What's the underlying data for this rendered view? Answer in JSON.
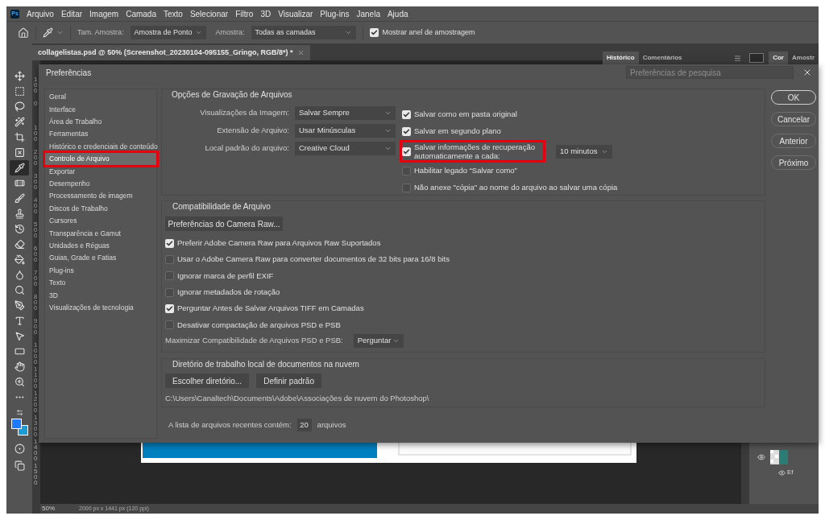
{
  "app": {
    "logo": "Ps",
    "menus": [
      "Arquivo",
      "Editar",
      "Imagem",
      "Camada",
      "Texto",
      "Selecionar",
      "Filtro",
      "3D",
      "Visualizar",
      "Plug-ins",
      "Janela",
      "Ajuda"
    ]
  },
  "options_bar": {
    "sample_size_label": "Tam. Amostra:",
    "sample_size": "Amostra de Ponto",
    "sample_label": "Amostra:",
    "sample": "Todas as camadas",
    "show_ring": {
      "label": "Mostrar anel de amostragem",
      "checked": true
    }
  },
  "tools": [
    {
      "kind": "move",
      "selected": false
    },
    {
      "kind": "marquee",
      "selected": false
    },
    {
      "kind": "lasso",
      "selected": false
    },
    {
      "kind": "wand",
      "selected": false
    },
    {
      "kind": "crop",
      "selected": false
    },
    {
      "kind": "frame",
      "selected": false
    },
    {
      "kind": "eyedropper",
      "selected": true
    },
    {
      "kind": "healing",
      "selected": false
    },
    {
      "kind": "brush",
      "selected": false
    },
    {
      "kind": "stamp",
      "selected": false
    },
    {
      "kind": "history",
      "selected": false
    },
    {
      "kind": "eraser",
      "selected": false
    },
    {
      "kind": "bucket",
      "selected": false
    },
    {
      "kind": "blur",
      "selected": false
    },
    {
      "kind": "dodge",
      "selected": false
    },
    {
      "kind": "pen",
      "selected": false
    },
    {
      "kind": "type",
      "selected": false
    },
    {
      "kind": "path",
      "selected": false
    },
    {
      "kind": "rectangle",
      "selected": false
    },
    {
      "kind": "hand",
      "selected": false
    },
    {
      "kind": "zoom",
      "selected": false
    },
    {
      "kind": "more",
      "selected": false
    }
  ],
  "document_tab": {
    "title": "collagelistas.psd @ 50% (Screenshot_20230104-095155_Gringo, RGB/8*) *"
  },
  "panel_tabs": [
    {
      "label": "Histórico",
      "selected": true
    },
    {
      "label": "Comentários",
      "selected": false
    }
  ],
  "panel_tabs_2": [
    {
      "label": "Cor",
      "selected": true
    },
    {
      "label": "Amostr",
      "selected": false
    }
  ],
  "ruler": [
    "100",
    "0",
    "100",
    "200",
    "300",
    "400",
    "500",
    "600",
    "700",
    "800",
    "900",
    "1000",
    "1100",
    "1200",
    "1300",
    "1400",
    "1500"
  ],
  "dialog": {
    "title": "Preferências",
    "search": {
      "placeholder": "Preferências de pesquisa"
    },
    "categories": [
      {
        "label": "Geral",
        "selected": false,
        "highlighted": false
      },
      {
        "label": "Interface",
        "selected": false,
        "highlighted": false
      },
      {
        "label": "Área de Trabalho",
        "selected": false,
        "highlighted": false
      },
      {
        "label": "Ferramentas",
        "selected": false,
        "highlighted": false
      },
      {
        "label": "Histórico e credenciais de conteúdo",
        "selected": false,
        "highlighted": false
      },
      {
        "label": "Controle de Arquivo",
        "selected": true,
        "highlighted": true
      },
      {
        "label": "Exportar",
        "selected": false,
        "highlighted": false
      },
      {
        "label": "Desempenho",
        "selected": false,
        "highlighted": false
      },
      {
        "label": "Processamento de imagem",
        "selected": false,
        "highlighted": false
      },
      {
        "label": "Discos de Trabalho",
        "selected": false,
        "highlighted": false
      },
      {
        "label": "Cursores",
        "selected": false,
        "highlighted": false
      },
      {
        "label": "Transparência e Gamut",
        "selected": false,
        "highlighted": false
      },
      {
        "label": "Unidades e Réguas",
        "selected": false,
        "highlighted": false
      },
      {
        "label": "Guias, Grade e Fatias",
        "selected": false,
        "highlighted": false
      },
      {
        "label": "Plug-ins",
        "selected": false,
        "highlighted": false
      },
      {
        "label": "Texto",
        "selected": false,
        "highlighted": false
      },
      {
        "label": "3D",
        "selected": false,
        "highlighted": false
      },
      {
        "label": "Visualizações de tecnologia",
        "selected": false,
        "highlighted": false
      }
    ],
    "save_options": {
      "title": "Opções de Gravação de Arquivos",
      "fields": [
        {
          "label": "Visualizações da Imagem:",
          "value": "Salvar Sempre"
        },
        {
          "label": "Extensão de Arquivo:",
          "value": "Usar Minúsculas"
        },
        {
          "label": "Local padrão do arquivo:",
          "value": "Creative Cloud"
        }
      ],
      "checkboxes": [
        {
          "label": "Salvar como em pasta original",
          "checked": true,
          "highlighted": false
        },
        {
          "label": "Salvar em segundo plano",
          "checked": true,
          "highlighted": false
        },
        {
          "label": "Salvar informações de recuperação automaticamente a cada:",
          "checked": true,
          "highlighted": true,
          "interval": "10 minutos"
        },
        {
          "label": "Habilitar legado “Salvar como”",
          "checked": false,
          "highlighted": false
        },
        {
          "label": "Não anexe \"cópia\" ao nome do arquivo ao salvar uma cópia",
          "checked": false,
          "highlighted": false
        }
      ]
    },
    "compatibility": {
      "title": "Compatibilidade de Arquivo",
      "camera_raw_button": "Preferências do Camera Raw...",
      "checkboxes": [
        {
          "label": "Preferir Adobe Camera Raw para Arquivos Raw Suportados",
          "checked": true
        },
        {
          "label": "Usar o Adobe Camera Raw para converter documentos de 32 bits para 16/8 bits",
          "checked": false
        },
        {
          "label": "Ignorar marca de perfil EXIF",
          "checked": false
        },
        {
          "label": "Ignorar metadados de rotação",
          "checked": false
        },
        {
          "label": "Perguntar Antes de Salvar Arquivos TIFF em Camadas",
          "checked": true
        },
        {
          "label": "Desativar compactação de arquivos PSD e PSB",
          "checked": false
        }
      ],
      "maximize_label": "Maximizar Compatibilidade de Arquivos PSD e PSB:",
      "maximize_value": "Perguntar"
    },
    "cloud": {
      "title": "Diretório de trabalho local de documentos na nuvem",
      "buttons": [
        "Escolher diretório...",
        "Definir padrão"
      ],
      "path": "C:\\Users\\Canaltech\\Documents\\Adobe\\Associações de nuvem do Photoshop\\"
    },
    "recent": {
      "label": "A lista de arquivos recentes contém:",
      "value": "20",
      "unit": "arquivos"
    },
    "buttons": [
      {
        "label": "OK",
        "primary": true
      },
      {
        "label": "Cancelar",
        "primary": false
      },
      {
        "label": "Anterior",
        "primary": false
      },
      {
        "label": "Próximo",
        "primary": false
      }
    ]
  },
  "layers": {
    "effect_label": "Ef"
  },
  "status_bar": {
    "zoom": "50%",
    "doc_info": "2000 px x 1441 px (120 ppi)"
  }
}
